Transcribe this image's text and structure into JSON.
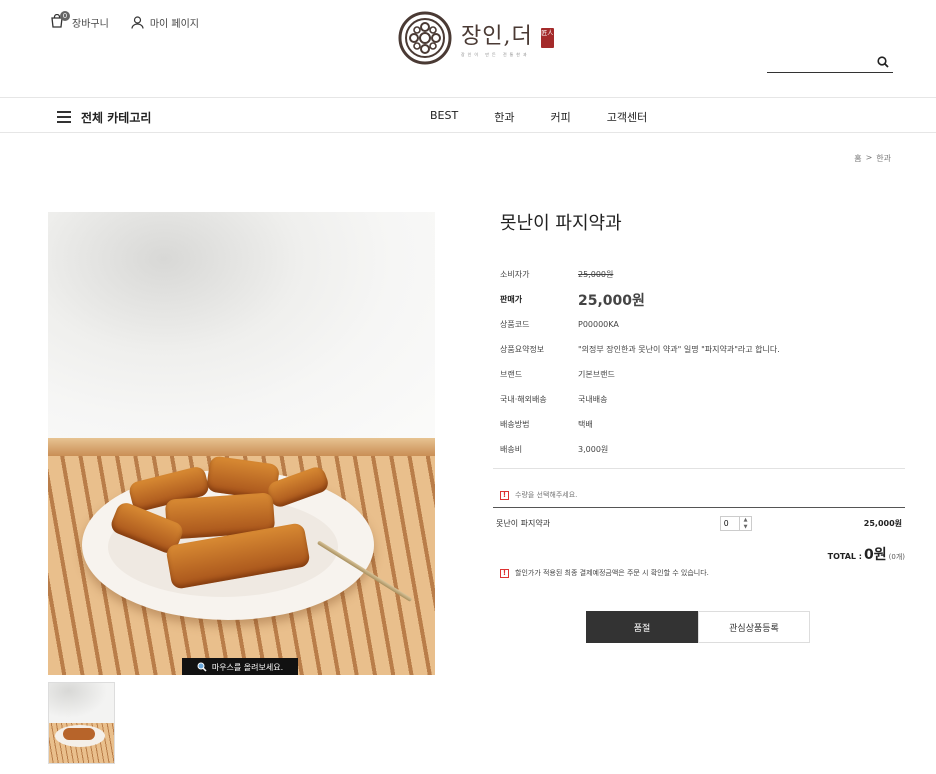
{
  "header": {
    "cart_label": "장바구니",
    "cart_count": "0",
    "mypage_label": "마이 페이지",
    "logo_name": "장인,더",
    "logo_tagline": "장인이 만든 전통한과",
    "logo_stamp": "匠人",
    "search_placeholder": ""
  },
  "nav": {
    "all_categories": "전체 카테고리",
    "menu": [
      "BEST",
      "한과",
      "커피",
      "고객센터"
    ]
  },
  "breadcrumb": [
    "홈",
    ">",
    "한과"
  ],
  "product": {
    "title": "못난이 파지약과",
    "zoom_hint": "마우스를 올려보세요.",
    "rows": [
      {
        "label": "소비자가",
        "value": "25,000원"
      },
      {
        "label": "판매가",
        "value": "25,000원"
      },
      {
        "label": "상품코드",
        "value": "P00000KA"
      },
      {
        "label": "상품요약정보",
        "value": "\"의정부 장인한과 못난이 약과\" 일명 \"파지약과\"라고 합니다."
      },
      {
        "label": "브랜드",
        "value": "기본브랜드"
      },
      {
        "label": "국내·해외배송",
        "value": "국내배송"
      },
      {
        "label": "배송방법",
        "value": "택배"
      },
      {
        "label": "배송비",
        "value": "3,000원"
      }
    ],
    "select_notice": "수량을 선택해주세요.",
    "option_name": "못난이 파지약과",
    "quantity": "0",
    "option_price": "25,000원",
    "total_label": "TOTAL :",
    "total_value": "0원",
    "total_count": "(0개)",
    "discount_notice": "할인가가 적용된 최종 결제예정금액은 주문 시 확인할 수 있습니다.",
    "soldout_button": "품절",
    "wishlist_button": "관심상품등록"
  }
}
